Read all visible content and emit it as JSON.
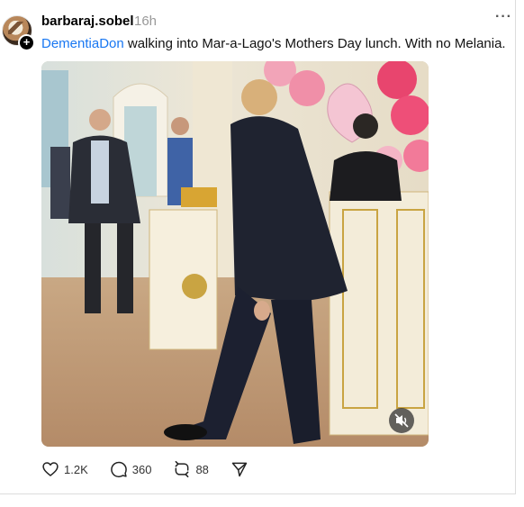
{
  "post": {
    "username": "barbaraj.sobel",
    "timestamp": "16h",
    "more_label": "···",
    "caption_mention": "DementiaDon",
    "caption_text": " walking into Mar-a-Lago's Mothers Day lunch. With no Melania.",
    "follow_badge": "+"
  },
  "media": {
    "type": "video",
    "muted": true
  },
  "actions": {
    "likes": "1.2K",
    "replies": "360",
    "reposts": "88"
  },
  "colors": {
    "mention": "#1877f2",
    "timestamp": "#999999"
  }
}
